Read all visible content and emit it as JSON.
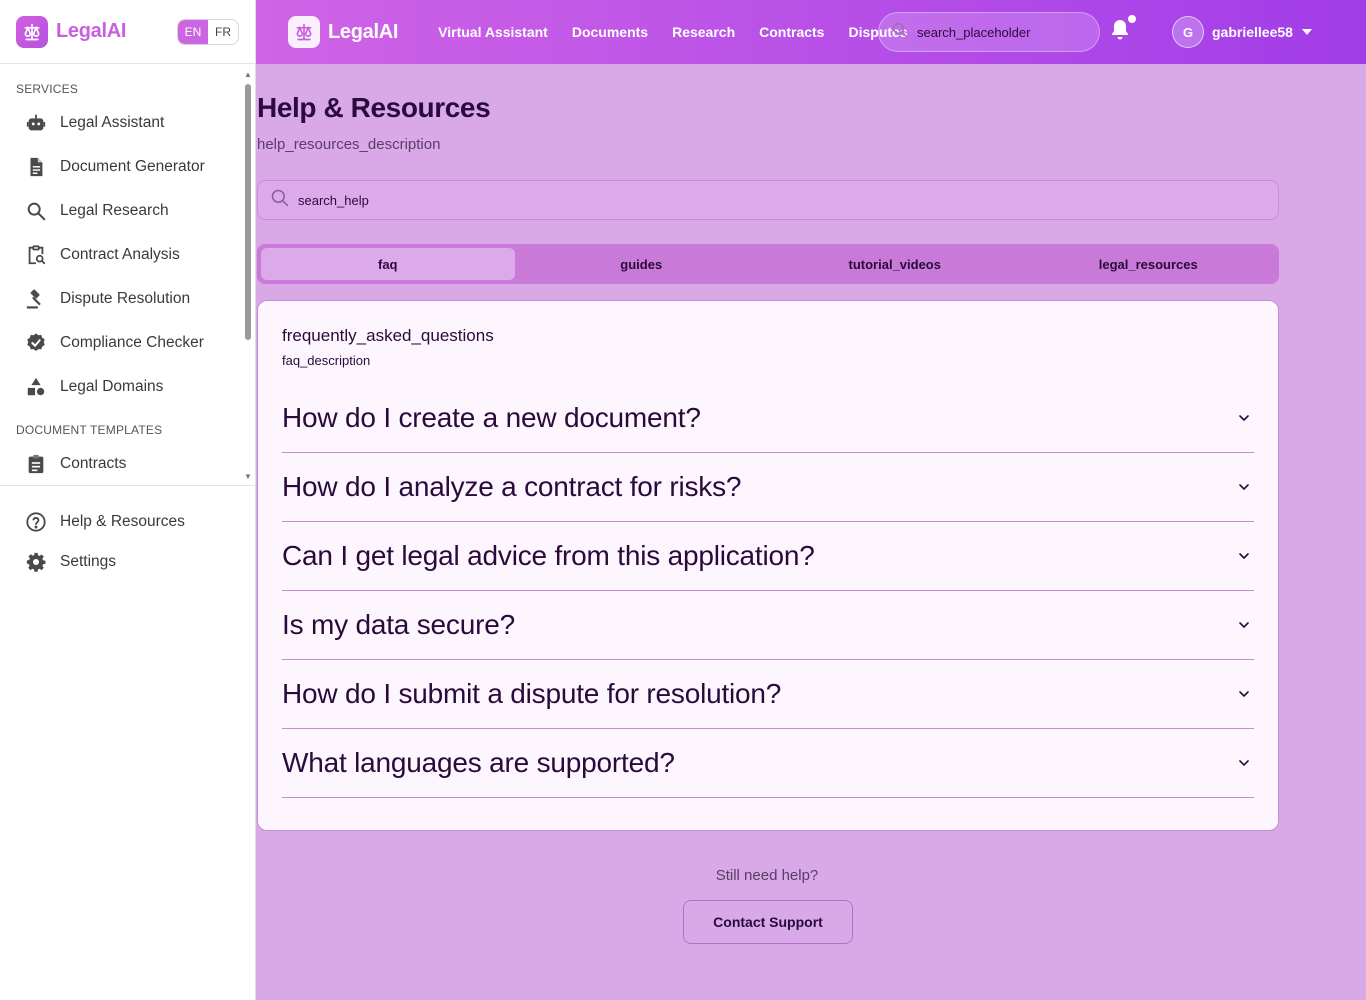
{
  "brand": {
    "name": "LegalAI"
  },
  "lang": {
    "en": "EN",
    "fr": "FR"
  },
  "sidebar": {
    "services_title": "SERVICES",
    "items": [
      {
        "label": "Legal Assistant",
        "icon": "robot-icon"
      },
      {
        "label": "Document Generator",
        "icon": "document-icon"
      },
      {
        "label": "Legal Research",
        "icon": "search-icon"
      },
      {
        "label": "Contract Analysis",
        "icon": "clipboard-search-icon"
      },
      {
        "label": "Dispute Resolution",
        "icon": "gavel-icon"
      },
      {
        "label": "Compliance Checker",
        "icon": "badge-check-icon"
      },
      {
        "label": "Legal Domains",
        "icon": "shapes-icon"
      }
    ],
    "templates_title": "DOCUMENT TEMPLATES",
    "templates": [
      {
        "label": "Contracts",
        "icon": "clipboard-icon"
      }
    ],
    "bottom": [
      {
        "label": "Help & Resources",
        "icon": "help-circle-icon"
      },
      {
        "label": "Settings",
        "icon": "gear-icon"
      }
    ]
  },
  "topbar": {
    "nav": [
      "Virtual Assistant",
      "Documents",
      "Research",
      "Contracts",
      "Disputes"
    ],
    "search_placeholder": "search_placeholder",
    "user": {
      "initial": "G",
      "name": "gabriellee58"
    }
  },
  "main": {
    "title": "Help & Resources",
    "description": "help_resources_description",
    "search_placeholder": "search_help",
    "tabs": [
      "faq",
      "guides",
      "tutorial_videos",
      "legal_resources"
    ],
    "active_tab": "faq",
    "card": {
      "title": "frequently_asked_questions",
      "description": "faq_description",
      "questions": [
        "How do I create a new document?",
        "How do I analyze a contract for risks?",
        "Can I get legal advice from this application?",
        "Is my data secure?",
        "How do I submit a dispute for resolution?",
        "What languages are supported?"
      ]
    },
    "still_need_help": "Still need help?",
    "contact_label": "Contact Support"
  },
  "colors": {
    "accent": "#cc66e0",
    "topbar_start": "#d064e6",
    "topbar_end": "#a13de8",
    "background": "#d9a8e6"
  }
}
